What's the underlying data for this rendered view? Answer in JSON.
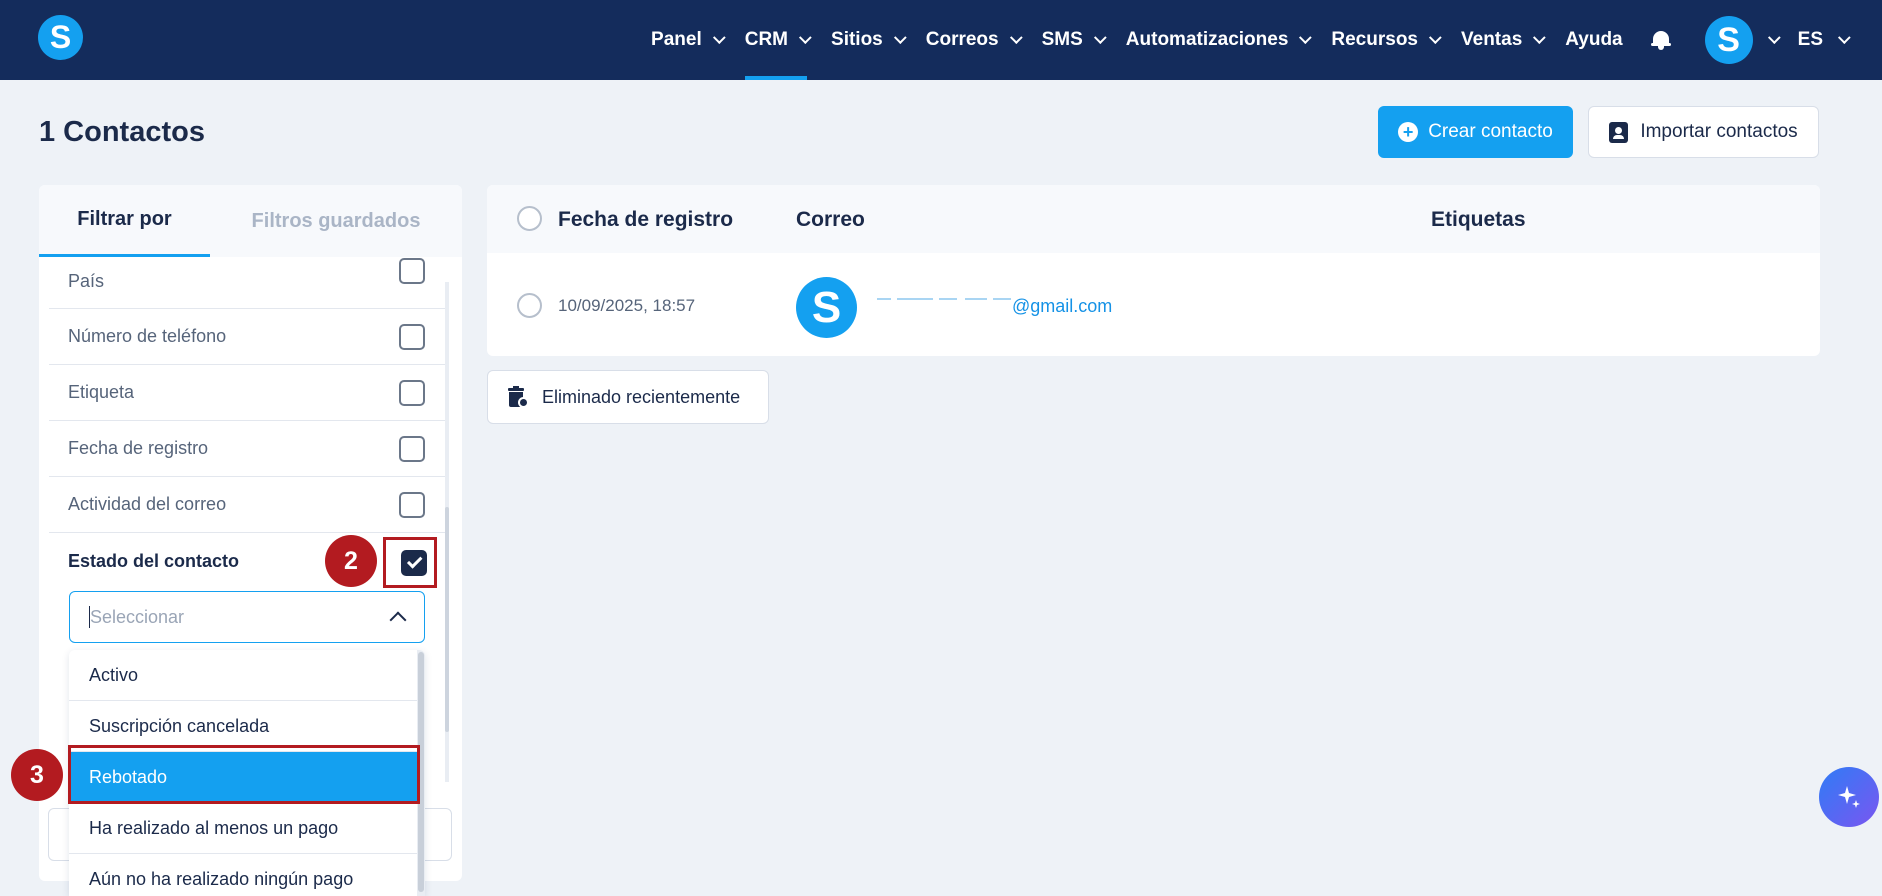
{
  "nav": {
    "logo_letter": "S",
    "items": [
      {
        "label": "Panel",
        "dropdown": true
      },
      {
        "label": "CRM",
        "dropdown": true,
        "active": true
      },
      {
        "label": "Sitios",
        "dropdown": true
      },
      {
        "label": "Correos",
        "dropdown": true
      },
      {
        "label": "SMS",
        "dropdown": true
      },
      {
        "label": "Automatizaciones",
        "dropdown": true
      },
      {
        "label": "Recursos",
        "dropdown": true
      },
      {
        "label": "Ventas",
        "dropdown": true
      },
      {
        "label": "Ayuda",
        "dropdown": false
      }
    ],
    "avatar_letter": "S",
    "language": "ES"
  },
  "page": {
    "title": "1 Contactos",
    "create_button": "Crear contacto",
    "import_button": "Importar contactos"
  },
  "filters": {
    "tabs": [
      "Filtrar por",
      "Filtros guardados"
    ],
    "rows": [
      {
        "label": "País",
        "checked": false
      },
      {
        "label": "Número de teléfono",
        "checked": false
      },
      {
        "label": "Etiqueta",
        "checked": false
      },
      {
        "label": "Fecha de registro",
        "checked": false
      },
      {
        "label": "Actividad del correo",
        "checked": false
      }
    ],
    "contact_status": {
      "label": "Estado del contacto",
      "checked": true,
      "placeholder": "Seleccionar",
      "options": [
        "Activo",
        "Suscripción cancelada",
        "Rebotado",
        "Ha realizado al menos un pago",
        "Aún no ha realizado ningún pago"
      ],
      "highlighted_option": "Rebotado"
    }
  },
  "annotations": {
    "step_checkbox": "2",
    "step_option": "3",
    "color": "#b31b20"
  },
  "table": {
    "headers": {
      "date": "Fecha de registro",
      "email": "Correo",
      "tags": "Etiquetas"
    },
    "rows": [
      {
        "date": "10/09/2025, 18:57",
        "avatar_letter": "S",
        "email_visible": "@gmail.com",
        "tags": ""
      }
    ]
  },
  "recently_deleted_button": "Eliminado recientemente",
  "colors": {
    "navbar": "#142c5c",
    "accent": "#14a0f0",
    "text_dark": "#1b2a4a"
  }
}
